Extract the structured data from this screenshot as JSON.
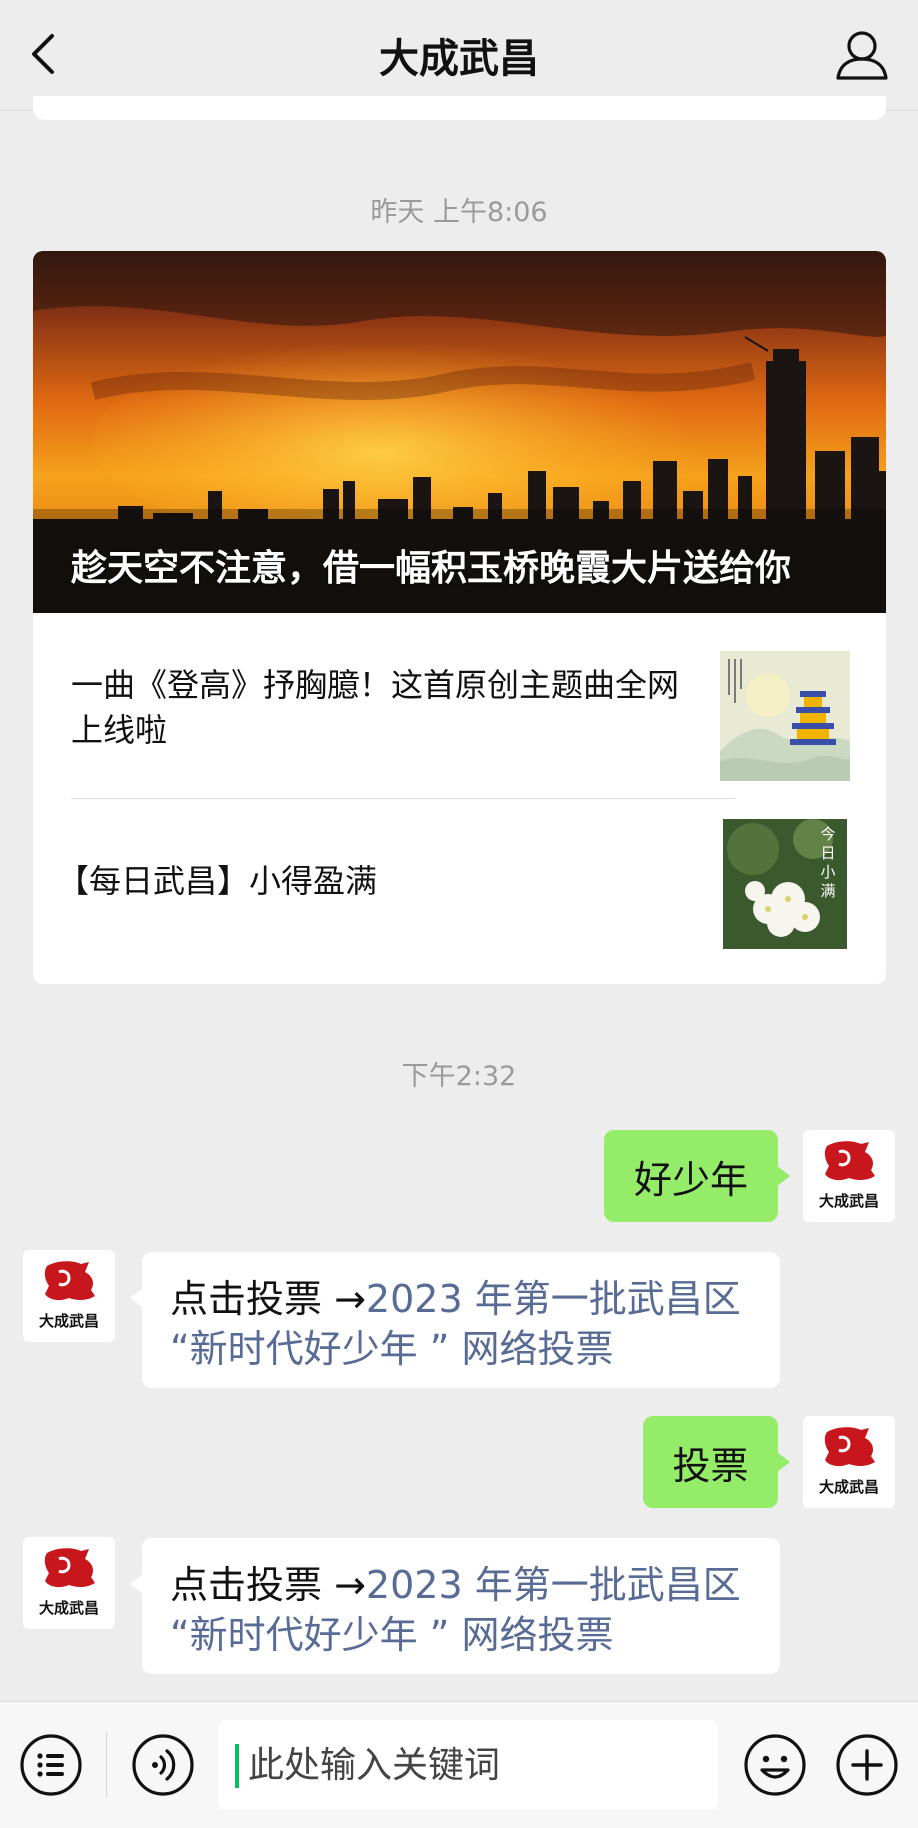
{
  "header": {
    "title": "大成武昌"
  },
  "timestamps": {
    "first": "昨天 上午8:06",
    "second": "下午2:32"
  },
  "article": {
    "cover_title": "趁天空不注意，借一幅积玉桥晚霞大片送给你",
    "items": [
      {
        "title": "一曲《登高》抒胸臆！这首原创主题曲全网上线啦"
      },
      {
        "title": "【每日武昌】小得盈满",
        "thumb_text": "今日小满"
      }
    ]
  },
  "messages": [
    {
      "side": "out",
      "text": "好少年"
    },
    {
      "side": "in",
      "prefix": "点击投票 →",
      "link": "2023 年第一批武昌区 “新时代好少年 ” 网络投票"
    },
    {
      "side": "out",
      "text": "投票"
    },
    {
      "side": "in",
      "prefix": "点击投票 →",
      "link": "2023 年第一批武昌区 “新时代好少年 ” 网络投票"
    }
  ],
  "avatar": {
    "label": "大成武昌",
    "brand_color": "#c8161d"
  },
  "input": {
    "placeholder": "此处输入关键词"
  },
  "colors": {
    "outgoing_bubble": "#95ec69",
    "link": "#576b95",
    "background": "#ededed"
  },
  "icons": {
    "back": "chevron-left-icon",
    "profile": "person-icon",
    "menu": "list-icon",
    "voice": "voice-icon",
    "emoji": "smiley-icon",
    "plus": "plus-icon"
  }
}
